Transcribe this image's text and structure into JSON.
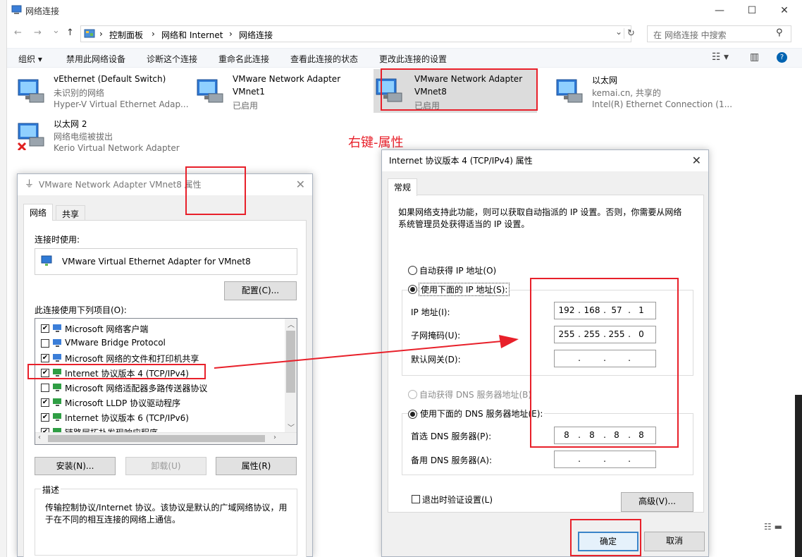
{
  "window": {
    "title": "网络连接",
    "controls": {
      "minimize": "—",
      "maximize": "☐",
      "close": "✕"
    }
  },
  "nav": {
    "back": "←",
    "forward": "→",
    "recent": "⌄",
    "up": "↑"
  },
  "address": {
    "breadcrumbs": [
      "控制面板",
      "网络和 Internet",
      "网络连接"
    ],
    "separator": "›",
    "search_placeholder": "在 网络连接 中搜索"
  },
  "toolbar": {
    "items": [
      "组织 ▾",
      "禁用此网络设备",
      "诊断这个连接",
      "重命名此连接",
      "查看此连接的状态",
      "更改此连接的设置"
    ]
  },
  "adapters": [
    {
      "name": "vEthernet (Default Switch)",
      "status": "未识别的网络",
      "device": "Hyper-V Virtual Ethernet Adap..."
    },
    {
      "name": "VMware Network Adapter",
      "name2": "VMnet1",
      "status": "已启用"
    },
    {
      "name": "VMware Network Adapter",
      "name2": "VMnet8",
      "status": "已启用"
    },
    {
      "name": "以太网",
      "status": "kemai.cn, 共享的",
      "device": "Intel(R) Ethernet Connection (1..."
    },
    {
      "name": "以太网 2",
      "status": "网络电缆被拔出",
      "device": "Kerio Virtual Network Adapter"
    }
  ],
  "annotation": {
    "right_click_note": "右键-属性"
  },
  "props_dialog": {
    "title": "VMware Network Adapter VMnet8 属性",
    "tabs": [
      "网络",
      "共享"
    ],
    "connect_using_label": "连接时使用:",
    "adapter_name": "VMware Virtual Ethernet Adapter for VMnet8",
    "configure_btn": "配置(C)...",
    "items_label": "此连接使用下列项目(O):",
    "items": [
      {
        "label": "Microsoft 网络客户端",
        "checked": true
      },
      {
        "label": "VMware Bridge Protocol",
        "checked": false
      },
      {
        "label": "Microsoft 网络的文件和打印机共享",
        "checked": true
      },
      {
        "label": "Internet 协议版本 4 (TCP/IPv4)",
        "checked": true
      },
      {
        "label": "Microsoft 网络适配器多路传送器协议",
        "checked": false
      },
      {
        "label": "Microsoft LLDP 协议驱动程序",
        "checked": true
      },
      {
        "label": "Internet 协议版本 6 (TCP/IPv6)",
        "checked": true
      },
      {
        "label": "链路层拓扑发现响应程序",
        "checked": true
      }
    ],
    "install_btn": "安装(N)...",
    "uninstall_btn": "卸载(U)",
    "properties_btn": "属性(R)",
    "desc_label": "描述",
    "description": "传输控制协议/Internet 协议。该协议是默认的广域网络协议，用于在不同的相互连接的网络上通信。",
    "close": "✕"
  },
  "ipv4_dialog": {
    "title": "Internet 协议版本 4 (TCP/IPv4) 属性",
    "tab": "常规",
    "intro": "如果网络支持此功能，则可以获取自动指派的 IP 设置。否则，你需要从网络系统管理员处获得适当的 IP 设置。",
    "auto_ip": "自动获得 IP 地址(O)",
    "use_ip": "使用下面的 IP 地址(S):",
    "ip_label": "IP 地址(I):",
    "ip": [
      "192",
      "168",
      "57",
      "1"
    ],
    "mask_label": "子网掩码(U):",
    "mask": [
      "255",
      "255",
      "255",
      "0"
    ],
    "gw_label": "默认网关(D):",
    "gateway": [
      "",
      "",
      "",
      ""
    ],
    "auto_dns": "自动获得 DNS 服务器地址(B)",
    "use_dns": "使用下面的 DNS 服务器地址(E):",
    "pref_dns_label": "首选 DNS 服务器(P):",
    "pref_dns": [
      "8",
      "8",
      "8",
      "8"
    ],
    "alt_dns_label": "备用 DNS 服务器(A):",
    "alt_dns": [
      "",
      "",
      "",
      ""
    ],
    "validate": "退出时验证设置(L)",
    "advanced_btn": "高级(V)...",
    "ok_btn": "确定",
    "cancel_btn": "取消",
    "dot": ".",
    "close": "✕"
  },
  "colors": {
    "annotation_red": "#e8202a",
    "accent_blue": "#0063b1"
  }
}
